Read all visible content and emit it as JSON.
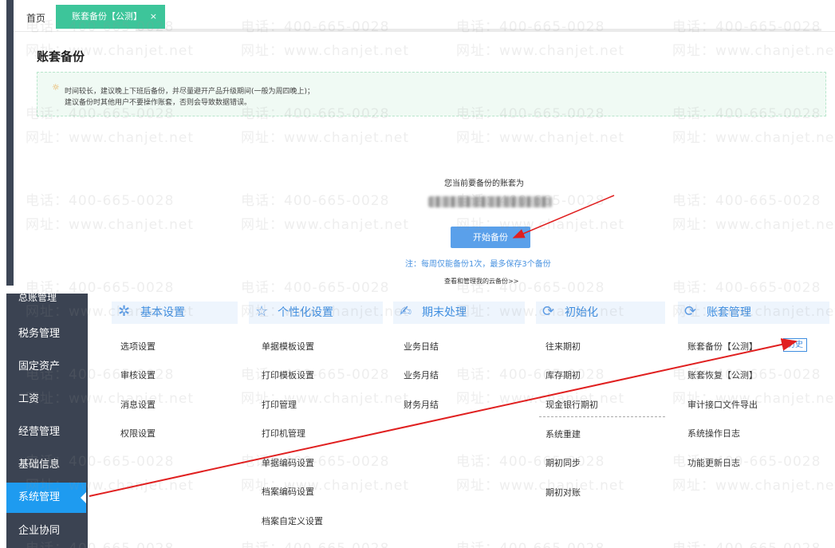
{
  "tabs": {
    "home": "首页",
    "active": "账套备份【公测】",
    "close": "×"
  },
  "page_title": "账套备份",
  "tip": {
    "line1": "时间较长，建议晚上下班后备份，并尽量避开产品升级期间(一般为周四晚上)；",
    "line2": "建议备份时其他用户不要操作账套，否则会导致数据错误。"
  },
  "backup": {
    "current_label": "您当前要备份的账套为",
    "start_button": "开始备份",
    "note": "注：每周仅能备份1次，最多保存3个备份",
    "cloud_link": "查看和管理我的云备份>>"
  },
  "sidebar": {
    "partial": "总账管理",
    "items": [
      {
        "label": "税务管理"
      },
      {
        "label": "固定资产"
      },
      {
        "label": "工资"
      },
      {
        "label": "经营管理"
      },
      {
        "label": "基础信息"
      },
      {
        "label": "系统管理"
      },
      {
        "label": "企业协同"
      }
    ]
  },
  "columns": [
    {
      "title": "基本设置",
      "icon": "settings-icon",
      "items": [
        "选项设置",
        "审核设置",
        "消息设置",
        "权限设置"
      ]
    },
    {
      "title": "个性化设置",
      "icon": "star-icon",
      "items": [
        "单据模板设置",
        "打印模板设置",
        "打印管理",
        "打印机管理",
        "单据编码设置",
        "档案编码设置",
        "档案自定义设置"
      ]
    },
    {
      "title": "期末处理",
      "icon": "period-end-icon",
      "items": [
        "业务日结",
        "业务月结",
        "财务月结"
      ]
    },
    {
      "title": "初始化",
      "icon": "init-icon",
      "items": [
        "往来期初",
        "库存期初",
        "现金银行期初",
        "系统重建",
        "期初同步",
        "期初对账"
      ]
    },
    {
      "title": "账套管理",
      "icon": "account-set-icon",
      "items": [
        "账套备份【公测】",
        "账套恢复【公测】",
        "审计接口文件导出",
        "系统操作日志",
        "功能更新日志"
      ]
    }
  ],
  "history_tag": "历史",
  "watermark": {
    "phone": "电话：400-665-0028",
    "site": "网址：www.chanjet.net"
  },
  "colors": {
    "tab_active": "#3dc59a",
    "primary_button": "#5aa0ea",
    "sidebar_bg": "#3b4352",
    "sidebar_active": "#1e9bf0",
    "annotation_arrow": "#e02020"
  }
}
